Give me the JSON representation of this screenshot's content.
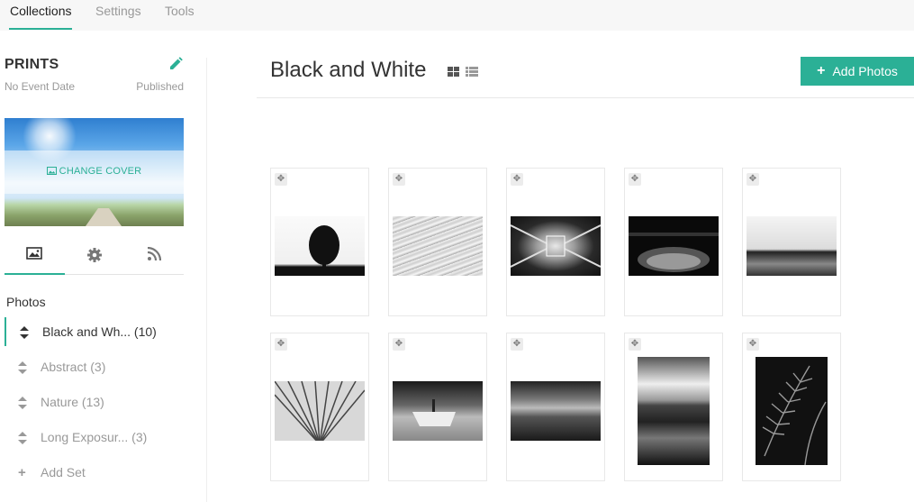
{
  "topnav": {
    "tabs": [
      "Collections",
      "Settings",
      "Tools"
    ],
    "active": "Collections"
  },
  "collection": {
    "title": "PRINTS",
    "event_date": "No Event Date",
    "status": "Published",
    "change_cover": "CHANGE COVER"
  },
  "sidebar": {
    "tabs": [
      "image-icon",
      "gear-icon",
      "rss-icon"
    ],
    "photos_heading": "Photos",
    "sets": [
      {
        "label": "Black and Wh... (10)",
        "active": true
      },
      {
        "label": "Abstract (3)",
        "active": false
      },
      {
        "label": "Nature (13)",
        "active": false
      },
      {
        "label": "Long Exposur... (3)",
        "active": false
      }
    ],
    "add_set": "Add Set"
  },
  "main": {
    "title": "Black and White",
    "add_button": "Add Photos",
    "photo_count_visible": 10
  },
  "colors": {
    "accent": "#2bb096",
    "text": "#333333",
    "muted": "#999999"
  }
}
